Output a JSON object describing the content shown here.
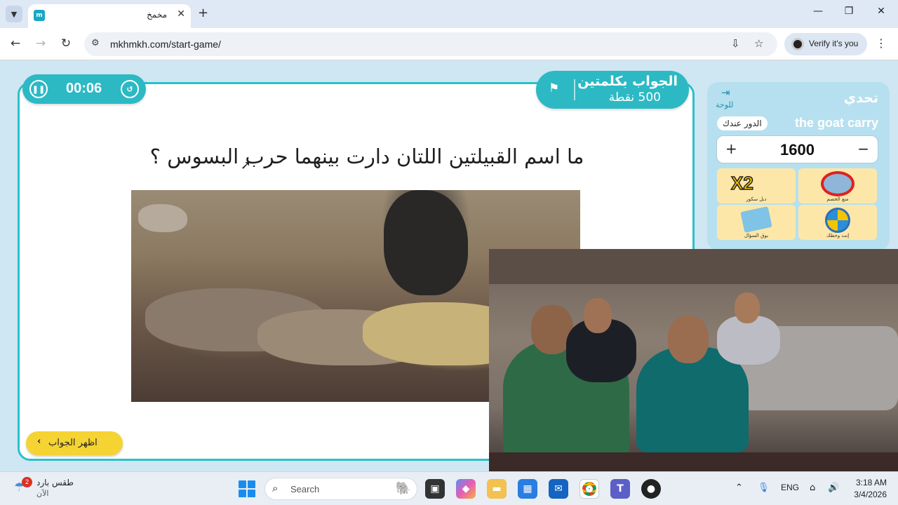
{
  "browser": {
    "tab_title": "مخمخ",
    "new_tab_glyph": "+",
    "url": "mkhmkh.com/start-game/",
    "verify_label": "Verify it's you"
  },
  "game": {
    "timer": "00:06",
    "question_type": "الجواب بكلمتين",
    "points": "500 نقطة",
    "question": "ما اسم القبيلتين اللتان دارت بينهما حرب البسوس ؟",
    "show_answer_label": "اظهر الجواب"
  },
  "panel": {
    "challenge_label": "تحدي",
    "board_label": "للوحة",
    "team_name": "the goat carry",
    "turn_label": "الدور عندك",
    "score": "1600",
    "aids": [
      {
        "label": "دبل سكور",
        "icon": "x2-icon"
      },
      {
        "label": "منع الخصم",
        "icon": "block-opponent-icon"
      },
      {
        "label": "بوق السؤال",
        "icon": "question-cards-icon"
      },
      {
        "label": "إنت وحظك",
        "icon": "wheel-of-luck-icon"
      }
    ],
    "x2_text": "X2"
  },
  "taskbar": {
    "weather_title": "طقس بارد",
    "weather_sub": "الآن",
    "weather_badge": "2",
    "search_label": "Search",
    "lang": "ENG",
    "time": "3:18 AM",
    "date": "3/4/2026"
  },
  "colors": {
    "accent": "#2cb9c4",
    "answer_button": "#f5d332",
    "panel_bg": "#b6e0ef"
  }
}
